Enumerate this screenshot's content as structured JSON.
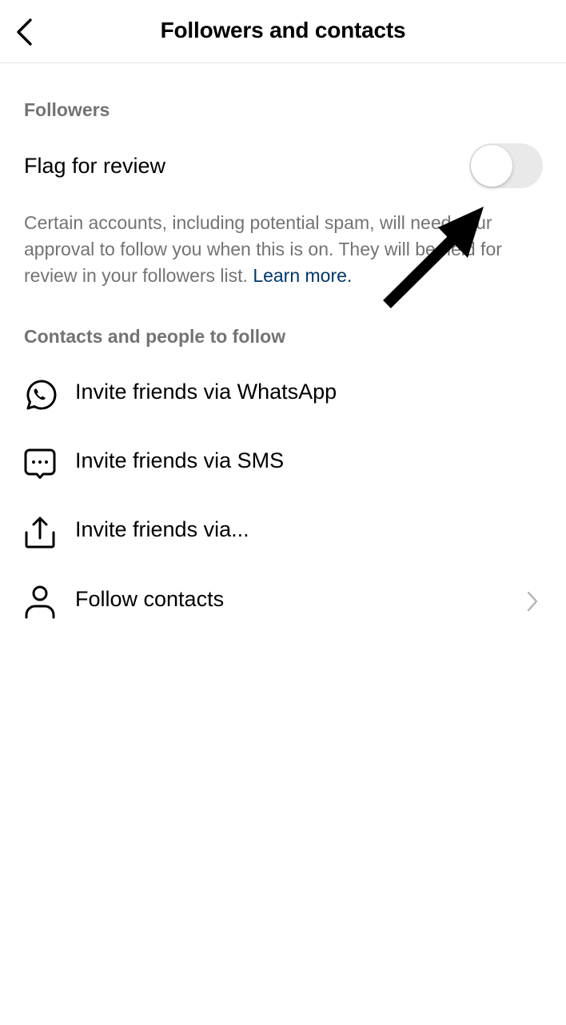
{
  "header": {
    "title": "Followers and contacts",
    "back_icon": "chevron-left-icon"
  },
  "followers": {
    "section_label": "Followers",
    "flag_for_review": {
      "label": "Flag for review",
      "enabled": false
    },
    "description": "Certain accounts, including potential spam, will need your approval to follow you when this is on. They will be held for review in your followers list.",
    "learn_more": "Learn more."
  },
  "contacts": {
    "section_label": "Contacts and people to follow",
    "items": [
      {
        "label": "Invite friends via WhatsApp",
        "icon": "whatsapp-icon",
        "chevron": false
      },
      {
        "label": "Invite friends via SMS",
        "icon": "sms-chat-icon",
        "chevron": false
      },
      {
        "label": "Invite friends via...",
        "icon": "share-icon",
        "chevron": false
      },
      {
        "label": "Follow contacts",
        "icon": "person-icon",
        "chevron": true
      }
    ]
  },
  "annotation": {
    "arrow_icon": "annotation-arrow-icon",
    "color": "#000000"
  },
  "colors": {
    "link": "#00376b",
    "secondary_text": "#737373",
    "toggle_off": "#e9e9ea"
  }
}
